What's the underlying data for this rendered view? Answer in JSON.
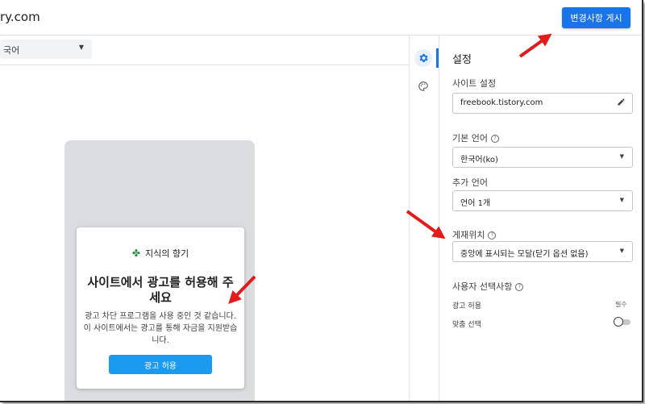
{
  "topbar": {
    "site_url": "ry.com",
    "publish_label": "변경사항 게시"
  },
  "preview": {
    "language_select": "국어",
    "dialog": {
      "brand": "지식의 향기",
      "title": "사이트에서 광고를 허용해 주세요",
      "body": "광고 차단 프로그램을 사용 중인 것 같습니다. 이 사이트에서는 광고를 통해 자금을 지원받습니다.",
      "allow_label": "광고 허용"
    }
  },
  "rail": {
    "icons": [
      "gear-icon",
      "palette-icon"
    ]
  },
  "settings": {
    "title": "설정",
    "site_settings_label": "사이트 설정",
    "site_domain": "freebook.tistory.com",
    "default_language_label": "기본 언어",
    "default_language": "한국어(ko)",
    "additional_language_label": "추가 언어",
    "additional_language": "언어 1개",
    "placement_label": "게재위치",
    "placement_value": "중앙에 표시되는 모달(닫기 옵션 없음)",
    "user_choices_label": "사용자 선택사항",
    "allow_ads_label": "광고 허용",
    "required_label": "필수",
    "custom_choice_label": "맞춤 선택"
  },
  "colors": {
    "accent": "#1a73e8",
    "allow_button": "#1a9bf0",
    "annotation_arrow": "#e31b1b"
  }
}
